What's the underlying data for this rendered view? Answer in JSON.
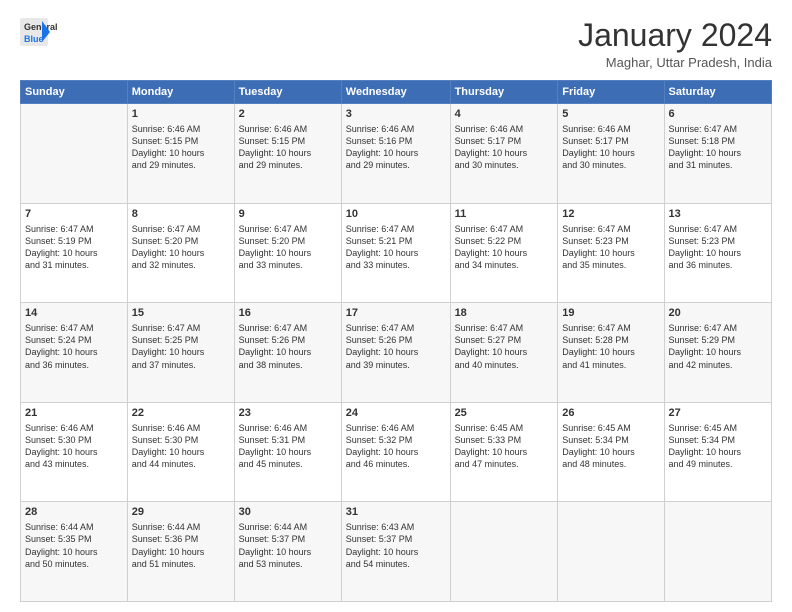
{
  "logo": {
    "line1": "General",
    "line2": "Blue"
  },
  "title": "January 2024",
  "subtitle": "Maghar, Uttar Pradesh, India",
  "days_header": [
    "Sunday",
    "Monday",
    "Tuesday",
    "Wednesday",
    "Thursday",
    "Friday",
    "Saturday"
  ],
  "weeks": [
    [
      {
        "day": "",
        "info": ""
      },
      {
        "day": "1",
        "info": "Sunrise: 6:46 AM\nSunset: 5:15 PM\nDaylight: 10 hours\nand 29 minutes."
      },
      {
        "day": "2",
        "info": "Sunrise: 6:46 AM\nSunset: 5:15 PM\nDaylight: 10 hours\nand 29 minutes."
      },
      {
        "day": "3",
        "info": "Sunrise: 6:46 AM\nSunset: 5:16 PM\nDaylight: 10 hours\nand 29 minutes."
      },
      {
        "day": "4",
        "info": "Sunrise: 6:46 AM\nSunset: 5:17 PM\nDaylight: 10 hours\nand 30 minutes."
      },
      {
        "day": "5",
        "info": "Sunrise: 6:46 AM\nSunset: 5:17 PM\nDaylight: 10 hours\nand 30 minutes."
      },
      {
        "day": "6",
        "info": "Sunrise: 6:47 AM\nSunset: 5:18 PM\nDaylight: 10 hours\nand 31 minutes."
      }
    ],
    [
      {
        "day": "7",
        "info": "Sunrise: 6:47 AM\nSunset: 5:19 PM\nDaylight: 10 hours\nand 31 minutes."
      },
      {
        "day": "8",
        "info": "Sunrise: 6:47 AM\nSunset: 5:20 PM\nDaylight: 10 hours\nand 32 minutes."
      },
      {
        "day": "9",
        "info": "Sunrise: 6:47 AM\nSunset: 5:20 PM\nDaylight: 10 hours\nand 33 minutes."
      },
      {
        "day": "10",
        "info": "Sunrise: 6:47 AM\nSunset: 5:21 PM\nDaylight: 10 hours\nand 33 minutes."
      },
      {
        "day": "11",
        "info": "Sunrise: 6:47 AM\nSunset: 5:22 PM\nDaylight: 10 hours\nand 34 minutes."
      },
      {
        "day": "12",
        "info": "Sunrise: 6:47 AM\nSunset: 5:23 PM\nDaylight: 10 hours\nand 35 minutes."
      },
      {
        "day": "13",
        "info": "Sunrise: 6:47 AM\nSunset: 5:23 PM\nDaylight: 10 hours\nand 36 minutes."
      }
    ],
    [
      {
        "day": "14",
        "info": "Sunrise: 6:47 AM\nSunset: 5:24 PM\nDaylight: 10 hours\nand 36 minutes."
      },
      {
        "day": "15",
        "info": "Sunrise: 6:47 AM\nSunset: 5:25 PM\nDaylight: 10 hours\nand 37 minutes."
      },
      {
        "day": "16",
        "info": "Sunrise: 6:47 AM\nSunset: 5:26 PM\nDaylight: 10 hours\nand 38 minutes."
      },
      {
        "day": "17",
        "info": "Sunrise: 6:47 AM\nSunset: 5:26 PM\nDaylight: 10 hours\nand 39 minutes."
      },
      {
        "day": "18",
        "info": "Sunrise: 6:47 AM\nSunset: 5:27 PM\nDaylight: 10 hours\nand 40 minutes."
      },
      {
        "day": "19",
        "info": "Sunrise: 6:47 AM\nSunset: 5:28 PM\nDaylight: 10 hours\nand 41 minutes."
      },
      {
        "day": "20",
        "info": "Sunrise: 6:47 AM\nSunset: 5:29 PM\nDaylight: 10 hours\nand 42 minutes."
      }
    ],
    [
      {
        "day": "21",
        "info": "Sunrise: 6:46 AM\nSunset: 5:30 PM\nDaylight: 10 hours\nand 43 minutes."
      },
      {
        "day": "22",
        "info": "Sunrise: 6:46 AM\nSunset: 5:30 PM\nDaylight: 10 hours\nand 44 minutes."
      },
      {
        "day": "23",
        "info": "Sunrise: 6:46 AM\nSunset: 5:31 PM\nDaylight: 10 hours\nand 45 minutes."
      },
      {
        "day": "24",
        "info": "Sunrise: 6:46 AM\nSunset: 5:32 PM\nDaylight: 10 hours\nand 46 minutes."
      },
      {
        "day": "25",
        "info": "Sunrise: 6:45 AM\nSunset: 5:33 PM\nDaylight: 10 hours\nand 47 minutes."
      },
      {
        "day": "26",
        "info": "Sunrise: 6:45 AM\nSunset: 5:34 PM\nDaylight: 10 hours\nand 48 minutes."
      },
      {
        "day": "27",
        "info": "Sunrise: 6:45 AM\nSunset: 5:34 PM\nDaylight: 10 hours\nand 49 minutes."
      }
    ],
    [
      {
        "day": "28",
        "info": "Sunrise: 6:44 AM\nSunset: 5:35 PM\nDaylight: 10 hours\nand 50 minutes."
      },
      {
        "day": "29",
        "info": "Sunrise: 6:44 AM\nSunset: 5:36 PM\nDaylight: 10 hours\nand 51 minutes."
      },
      {
        "day": "30",
        "info": "Sunrise: 6:44 AM\nSunset: 5:37 PM\nDaylight: 10 hours\nand 53 minutes."
      },
      {
        "day": "31",
        "info": "Sunrise: 6:43 AM\nSunset: 5:37 PM\nDaylight: 10 hours\nand 54 minutes."
      },
      {
        "day": "",
        "info": ""
      },
      {
        "day": "",
        "info": ""
      },
      {
        "day": "",
        "info": ""
      }
    ]
  ]
}
